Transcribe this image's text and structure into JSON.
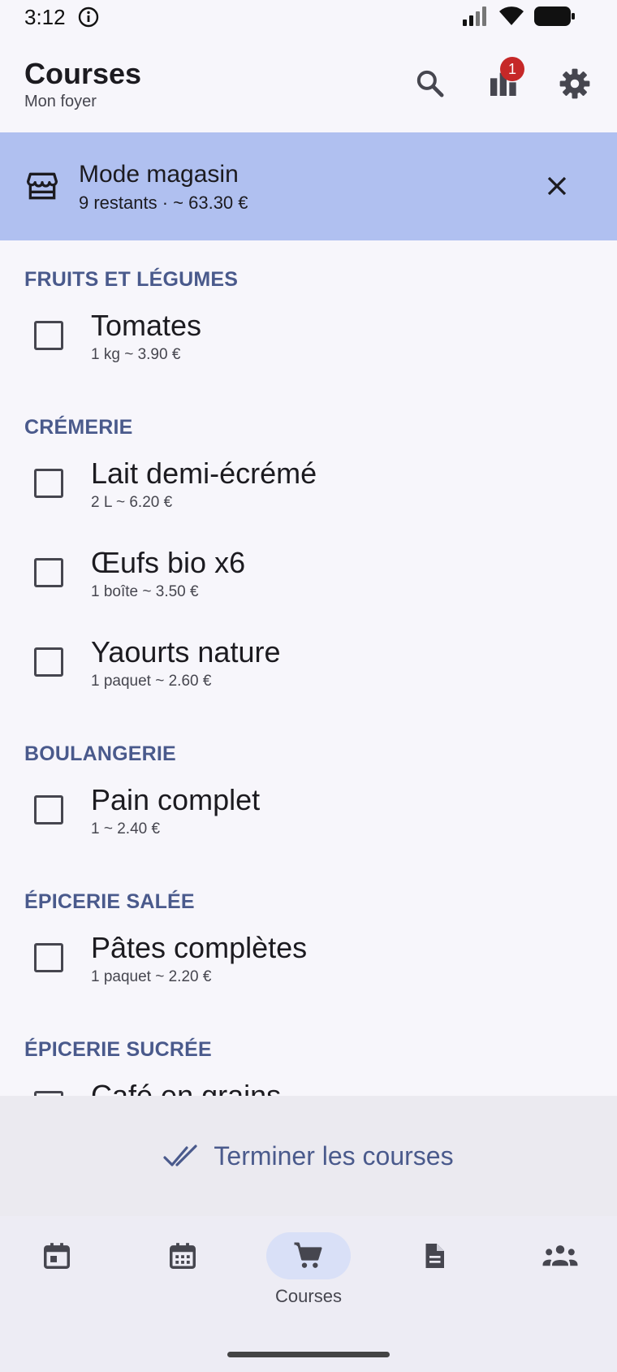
{
  "status_bar": {
    "time": "3:12"
  },
  "header": {
    "title": "Courses",
    "subtitle": "Mon foyer",
    "notification_count": "1"
  },
  "banner": {
    "title": "Mode magasin",
    "subtitle": "9 restants · ~ 63.30 €"
  },
  "sections": [
    {
      "title": "FRUITS ET LÉGUMES",
      "items": [
        {
          "name": "Tomates",
          "meta": "1 kg  ~ 3.90 €"
        }
      ]
    },
    {
      "title": "CRÉMERIE",
      "items": [
        {
          "name": "Lait demi-écrémé",
          "meta": "2 L  ~ 6.20 €"
        },
        {
          "name": "Œufs bio x6",
          "meta": "1 boîte  ~ 3.50 €"
        },
        {
          "name": "Yaourts nature",
          "meta": "1 paquet  ~ 2.60 €"
        }
      ]
    },
    {
      "title": "BOULANGERIE",
      "items": [
        {
          "name": "Pain complet",
          "meta": "1  ~ 2.40 €"
        }
      ]
    },
    {
      "title": "ÉPICERIE SALÉE",
      "items": [
        {
          "name": "Pâtes complètes",
          "meta": "1 paquet  ~ 2.20 €"
        }
      ]
    },
    {
      "title": "ÉPICERIE SUCRÉE",
      "items": [
        {
          "name": "Café en grains",
          "meta": ""
        }
      ]
    }
  ],
  "finish_button": {
    "label": "Terminer les courses"
  },
  "bottom_nav": {
    "active_label": "Courses",
    "items": [
      {
        "icon": "calendar-today-icon"
      },
      {
        "icon": "calendar-month-icon"
      },
      {
        "icon": "cart-icon"
      },
      {
        "icon": "document-icon"
      },
      {
        "icon": "group-icon"
      }
    ]
  },
  "colors": {
    "banner": "#b0c0f0",
    "section_header": "#4a5a8c",
    "badge": "#c62828",
    "nav_active_pill": "#d9e0f7"
  }
}
